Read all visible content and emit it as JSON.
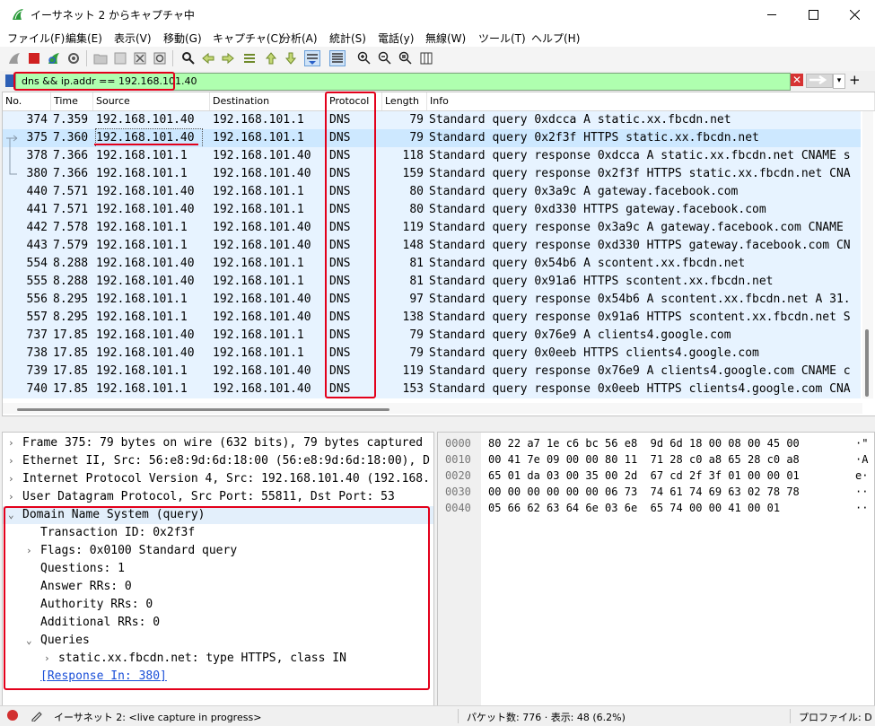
{
  "window": {
    "title": "イーサネット 2 からキャプチャ中"
  },
  "menu": [
    "ファイル(F)",
    "編集(E)",
    "表示(V)",
    "移動(G)",
    "キャプチャ(C)",
    "分析(A)",
    "統計(S)",
    "電話(y)",
    "無線(W)",
    "ツール(T)",
    "ヘルプ(H)"
  ],
  "toolbar": {
    "icons": [
      "shark-fin-start-icon",
      "stop-icon",
      "restart-icon",
      "options-gear-icon",
      "open-folder-icon",
      "save-icon",
      "close-file-icon",
      "reload-icon",
      "find-icon",
      "go-back-icon",
      "go-forward-icon",
      "go-to-packet-icon",
      "go-first-icon",
      "go-last-icon",
      "autoscroll-icon",
      "colorize-icon",
      "zoom-in-icon",
      "zoom-out-icon",
      "zoom-normal-icon",
      "resize-columns-icon"
    ]
  },
  "filter": {
    "value": "dns && ip.addr == 192.168.101.40"
  },
  "packet_list": {
    "columns": [
      "No.",
      "Time",
      "Source",
      "Destination",
      "Protocol",
      "Length",
      "Info"
    ],
    "rows": [
      {
        "no": "374",
        "time": "7.359",
        "src": "192.168.101.40",
        "dst": "192.168.101.1",
        "proto": "DNS",
        "len": "79",
        "info": "Standard query 0xdcca A static.xx.fbcdn.net"
      },
      {
        "no": "375",
        "time": "7.360",
        "src": "192.168.101.40",
        "dst": "192.168.101.1",
        "proto": "DNS",
        "len": "79",
        "info": "Standard query 0x2f3f HTTPS static.xx.fbcdn.net"
      },
      {
        "no": "378",
        "time": "7.366",
        "src": "192.168.101.1",
        "dst": "192.168.101.40",
        "proto": "DNS",
        "len": "118",
        "info": "Standard query response 0xdcca A static.xx.fbcdn.net CNAME s"
      },
      {
        "no": "380",
        "time": "7.366",
        "src": "192.168.101.1",
        "dst": "192.168.101.40",
        "proto": "DNS",
        "len": "159",
        "info": "Standard query response 0x2f3f HTTPS static.xx.fbcdn.net CNA"
      },
      {
        "no": "440",
        "time": "7.571",
        "src": "192.168.101.40",
        "dst": "192.168.101.1",
        "proto": "DNS",
        "len": "80",
        "info": "Standard query 0x3a9c A gateway.facebook.com"
      },
      {
        "no": "441",
        "time": "7.571",
        "src": "192.168.101.40",
        "dst": "192.168.101.1",
        "proto": "DNS",
        "len": "80",
        "info": "Standard query 0xd330 HTTPS gateway.facebook.com"
      },
      {
        "no": "442",
        "time": "7.578",
        "src": "192.168.101.1",
        "dst": "192.168.101.40",
        "proto": "DNS",
        "len": "119",
        "info": "Standard query response 0x3a9c A gateway.facebook.com CNAME"
      },
      {
        "no": "443",
        "time": "7.579",
        "src": "192.168.101.1",
        "dst": "192.168.101.40",
        "proto": "DNS",
        "len": "148",
        "info": "Standard query response 0xd330 HTTPS gateway.facebook.com CN"
      },
      {
        "no": "554",
        "time": "8.288",
        "src": "192.168.101.40",
        "dst": "192.168.101.1",
        "proto": "DNS",
        "len": "81",
        "info": "Standard query 0x54b6 A scontent.xx.fbcdn.net"
      },
      {
        "no": "555",
        "time": "8.288",
        "src": "192.168.101.40",
        "dst": "192.168.101.1",
        "proto": "DNS",
        "len": "81",
        "info": "Standard query 0x91a6 HTTPS scontent.xx.fbcdn.net"
      },
      {
        "no": "556",
        "time": "8.295",
        "src": "192.168.101.1",
        "dst": "192.168.101.40",
        "proto": "DNS",
        "len": "97",
        "info": "Standard query response 0x54b6 A scontent.xx.fbcdn.net A 31."
      },
      {
        "no": "557",
        "time": "8.295",
        "src": "192.168.101.1",
        "dst": "192.168.101.40",
        "proto": "DNS",
        "len": "138",
        "info": "Standard query response 0x91a6 HTTPS scontent.xx.fbcdn.net S"
      },
      {
        "no": "737",
        "time": "17.85",
        "src": "192.168.101.40",
        "dst": "192.168.101.1",
        "proto": "DNS",
        "len": "79",
        "info": "Standard query 0x76e9 A clients4.google.com"
      },
      {
        "no": "738",
        "time": "17.85",
        "src": "192.168.101.40",
        "dst": "192.168.101.1",
        "proto": "DNS",
        "len": "79",
        "info": "Standard query 0x0eeb HTTPS clients4.google.com"
      },
      {
        "no": "739",
        "time": "17.85",
        "src": "192.168.101.1",
        "dst": "192.168.101.40",
        "proto": "DNS",
        "len": "119",
        "info": "Standard query response 0x76e9 A clients4.google.com CNAME c"
      },
      {
        "no": "740",
        "time": "17.85",
        "src": "192.168.101.1",
        "dst": "192.168.101.40",
        "proto": "DNS",
        "len": "153",
        "info": "Standard query response 0x0eeb HTTPS clients4.google.com CNA"
      }
    ]
  },
  "details": [
    {
      "arrow": "›",
      "text": "Frame 375: 79 bytes on wire (632 bits), 79 bytes captured"
    },
    {
      "arrow": "›",
      "text": "Ethernet II, Src: 56:e8:9d:6d:18:00 (56:e8:9d:6d:18:00), D"
    },
    {
      "arrow": "›",
      "text": "Internet Protocol Version 4, Src: 192.168.101.40 (192.168."
    },
    {
      "arrow": "›",
      "text": "User Datagram Protocol, Src Port: 55811, Dst Port: 53"
    },
    {
      "arrow": "⌄",
      "text": "Domain Name System (query)"
    },
    {
      "arrow": "",
      "text": "Transaction ID: 0x2f3f"
    },
    {
      "arrow": "›",
      "text": "Flags: 0x0100 Standard query"
    },
    {
      "arrow": "",
      "text": "Questions: 1"
    },
    {
      "arrow": "",
      "text": "Answer RRs: 0"
    },
    {
      "arrow": "",
      "text": "Authority RRs: 0"
    },
    {
      "arrow": "",
      "text": "Additional RRs: 0"
    },
    {
      "arrow": "⌄",
      "text": "Queries"
    },
    {
      "arrow": "›",
      "text": "static.xx.fbcdn.net: type HTTPS, class IN"
    },
    {
      "arrow": "",
      "text": "[Response In: 380]"
    }
  ],
  "bytes": [
    {
      "offset": "0000",
      "hex": "80 22 a7 1e c6 bc 56 e8  9d 6d 18 00 08 00 45 00",
      "ascii": "·\""
    },
    {
      "offset": "0010",
      "hex": "00 41 7e 09 00 00 80 11  71 28 c0 a8 65 28 c0 a8",
      "ascii": "·A"
    },
    {
      "offset": "0020",
      "hex": "65 01 da 03 00 35 00 2d  67 cd 2f 3f 01 00 00 01",
      "ascii": "e·"
    },
    {
      "offset": "0030",
      "hex": "00 00 00 00 00 00 06 73  74 61 74 69 63 02 78 78",
      "ascii": "··"
    },
    {
      "offset": "0040",
      "hex": "05 66 62 63 64 6e 03 6e  65 74 00 00 41 00 01",
      "ascii": "··"
    }
  ],
  "status": {
    "interface": "イーサネット 2: <live capture in progress>",
    "packets": "パケット数: 776 · 表示: 48 (6.2%)",
    "profile": "プロファイル: D"
  },
  "colors": {
    "highlight": "#e3001b",
    "row_bg": "#e7f3ff",
    "selected_row_bg": "#cde8ff",
    "filter_ok_bg": "#afffaf"
  }
}
